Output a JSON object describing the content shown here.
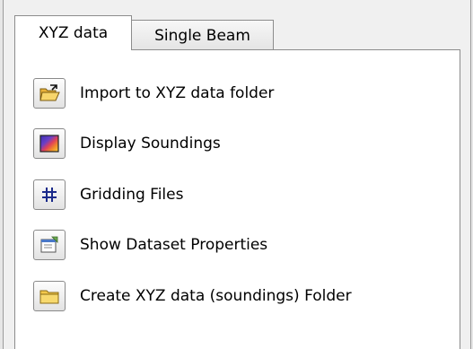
{
  "tabs": [
    {
      "label": "XYZ data",
      "active": true
    },
    {
      "label": "Single Beam",
      "active": false
    }
  ],
  "actions": [
    {
      "label": "Import to XYZ data folder",
      "icon": "open-folder-icon"
    },
    {
      "label": "Display Soundings",
      "icon": "color-map-icon"
    },
    {
      "label": "Gridding Files",
      "icon": "grid-icon"
    },
    {
      "label": "Show Dataset Properties",
      "icon": "properties-icon"
    },
    {
      "label": "Create XYZ data (soundings) Folder",
      "icon": "folder-icon"
    }
  ]
}
